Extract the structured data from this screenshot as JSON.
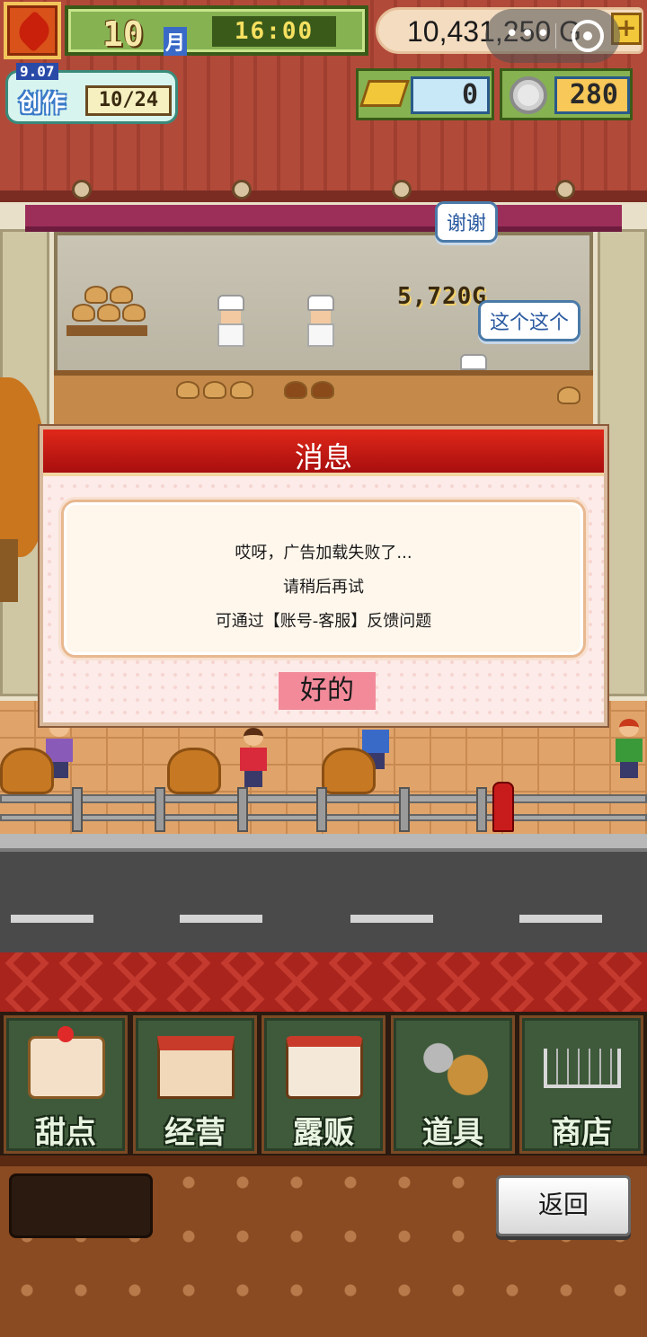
{
  "hud": {
    "month_number": "10",
    "month_label": "月",
    "time": "16:00",
    "money": "10,431,250 G",
    "plus_label": "+",
    "create_date": "9.07",
    "create_label": "创作",
    "create_count": "10/24",
    "gold_bars": "0",
    "plates": "280"
  },
  "scene": {
    "shop_earnings": "5,720G",
    "bubble_thanks": "谢谢",
    "bubble_this_one": "这个这个"
  },
  "dialog": {
    "title": "消息",
    "lines": [
      "哎呀，广告加载失败了...",
      "请稍后再试",
      "可通过【账号-客服】反馈问题"
    ],
    "ok_label": "好的"
  },
  "menu": {
    "items": [
      {
        "label": "甜点",
        "icon": "cake-icon"
      },
      {
        "label": "经营",
        "icon": "shop-icon"
      },
      {
        "label": "露贩",
        "icon": "food-truck-icon"
      },
      {
        "label": "道具",
        "icon": "tools-icon"
      },
      {
        "label": "商店",
        "icon": "cart-icon"
      }
    ]
  },
  "footer": {
    "back_label": "返回"
  },
  "colors": {
    "dialog_header": "#c8180e",
    "ok_button": "#f28a9a",
    "menu_tile": "#3e5a3a"
  }
}
